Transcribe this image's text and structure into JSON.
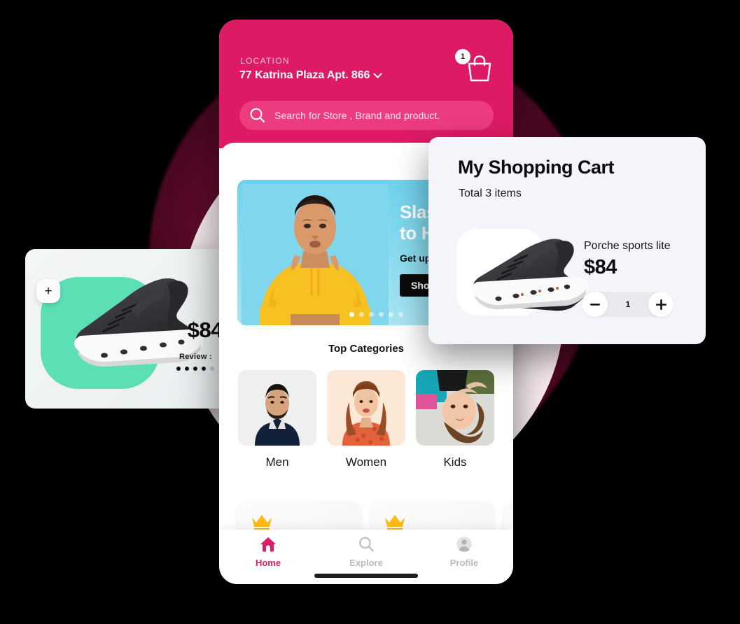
{
  "theme": {
    "brand_pink": "#de1a66",
    "search_pink": "#ec3c7f",
    "teal_blob": "#5ddfb6",
    "banner_sky": "#8ddcef",
    "crown_gold": "#fdbb16",
    "canvas": "#000000",
    "circle_pink": "#fbeef1",
    "circle_crimson": "#6d0b30"
  },
  "product_card": {
    "price": "$84",
    "review_label": "Review :",
    "rating_dots": [
      true,
      true,
      true,
      true,
      false
    ],
    "add_button": "+"
  },
  "phone": {
    "header": {
      "location_label": "LOCATION",
      "location_value": "77 Katrina Plaza Apt. 866",
      "cart_badge": "1"
    },
    "search": {
      "placeholder": "Search for Store , Brand and product."
    },
    "banner": {
      "headline": "Slas\nto H",
      "subtext": "Get upto",
      "cta": "Shop",
      "dots_total": 6,
      "dots_active": 1
    },
    "categories": {
      "title": "Top Categories",
      "items": [
        {
          "label": "Men"
        },
        {
          "label": "Women"
        },
        {
          "label": "Kids"
        }
      ]
    },
    "product_row": [
      {
        "badge": "crown"
      },
      {
        "badge": "crown"
      },
      {
        "badge": "crown"
      }
    ],
    "tabbar": [
      {
        "label": "Home",
        "icon": "home-icon",
        "active": true
      },
      {
        "label": "Explore",
        "icon": "search-icon",
        "active": false
      },
      {
        "label": "Profile",
        "icon": "person-icon",
        "active": false
      }
    ]
  },
  "cart": {
    "title": "My Shopping Cart",
    "subtitle": "Total 3 items",
    "item": {
      "name": "Porche sports lite",
      "price": "$84",
      "quantity": "1",
      "decrement": "−",
      "increment": "+"
    }
  }
}
